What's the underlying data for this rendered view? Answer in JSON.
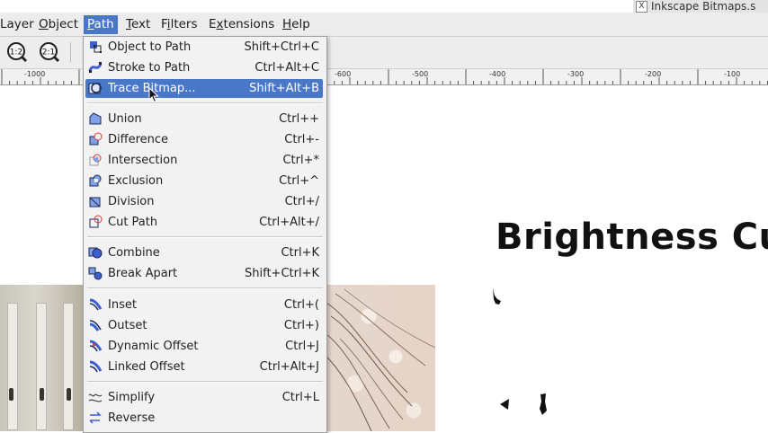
{
  "window": {
    "title": "Inkscape Bitmaps.s"
  },
  "menubar": {
    "items": [
      {
        "label": "Layer",
        "underline": "",
        "active": false
      },
      {
        "label": "Object",
        "underline": "O",
        "active": false
      },
      {
        "label": "Path",
        "underline": "P",
        "active": true
      },
      {
        "label": "Text",
        "underline": "T",
        "active": false
      },
      {
        "label": "Filters",
        "underline": "i",
        "active": false
      },
      {
        "label": "Extensions",
        "underline": "x",
        "active": false
      },
      {
        "label": "Help",
        "underline": "H",
        "active": false
      }
    ]
  },
  "toolbar": {
    "zoom_1_2_label": "1:2",
    "zoom_2_1_label": "2:1"
  },
  "ruler": {
    "labels": [
      "-1000",
      "-600",
      "-500",
      "-400",
      "-300",
      "-200",
      "-100"
    ]
  },
  "path_menu": {
    "items": [
      {
        "label": "Object to Path",
        "accel": "Shift+Ctrl+C",
        "icon": "object-to-path-icon"
      },
      {
        "label": "Stroke to Path",
        "accel": "Ctrl+Alt+C",
        "icon": "stroke-to-path-icon"
      },
      {
        "label": "Trace Bitmap...",
        "accel": "Shift+Alt+B",
        "icon": "trace-bitmap-icon",
        "highlighted": true
      },
      {
        "label": "Union",
        "accel": "Ctrl++",
        "icon": "union-icon"
      },
      {
        "label": "Difference",
        "accel": "Ctrl+-",
        "icon": "difference-icon"
      },
      {
        "label": "Intersection",
        "accel": "Ctrl+*",
        "icon": "intersection-icon"
      },
      {
        "label": "Exclusion",
        "accel": "Ctrl+^",
        "icon": "exclusion-icon"
      },
      {
        "label": "Division",
        "accel": "Ctrl+/",
        "icon": "division-icon"
      },
      {
        "label": "Cut Path",
        "accel": "Ctrl+Alt+/",
        "icon": "cut-path-icon"
      },
      {
        "label": "Combine",
        "accel": "Ctrl+K",
        "icon": "combine-icon"
      },
      {
        "label": "Break Apart",
        "accel": "Shift+Ctrl+K",
        "icon": "break-apart-icon"
      },
      {
        "label": "Inset",
        "accel": "Ctrl+(",
        "icon": "inset-icon"
      },
      {
        "label": "Outset",
        "accel": "Ctrl+)",
        "icon": "outset-icon"
      },
      {
        "label": "Dynamic Offset",
        "accel": "Ctrl+J",
        "icon": "dynamic-offset-icon"
      },
      {
        "label": "Linked Offset",
        "accel": "Ctrl+Alt+J",
        "icon": "linked-offset-icon"
      },
      {
        "label": "Simplify",
        "accel": "Ctrl+L",
        "icon": "simplify-icon"
      },
      {
        "label": "Reverse",
        "accel": "",
        "icon": "reverse-icon"
      }
    ]
  },
  "canvas": {
    "heading": "Brightness Cu"
  },
  "colors": {
    "accent": "#4a78c8",
    "menu_bg": "#f2f2f2",
    "icon_blue": "#3b5fd1",
    "icon_red": "#d23a3a"
  }
}
